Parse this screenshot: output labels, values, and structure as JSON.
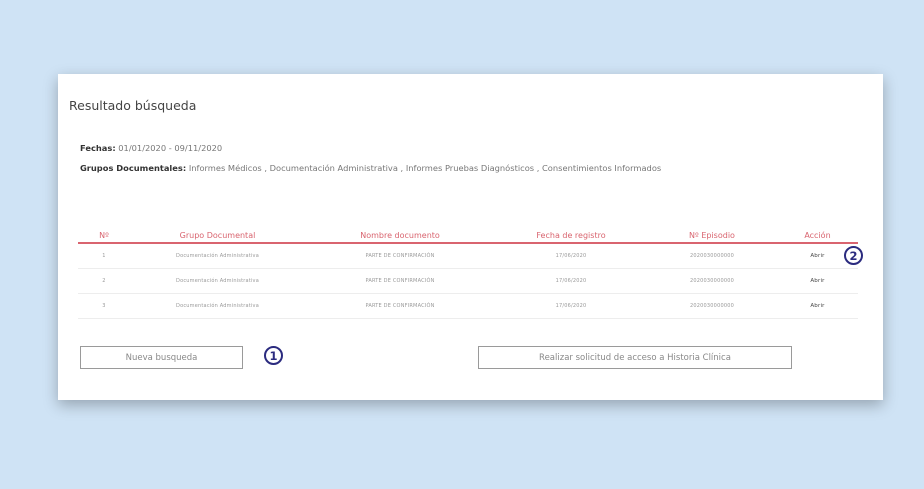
{
  "page": {
    "title": "Resultado búsqueda",
    "filters": {
      "fechas_label": "Fechas:",
      "fechas_value": "01/01/2020 - 09/11/2020",
      "grupos_label": "Grupos Documentales:",
      "grupos_value": "Informes Médicos , Documentación Administrativa , Informes Pruebas Diagnósticos , Consentimientos Informados"
    },
    "table": {
      "columns": [
        "Nº",
        "Grupo Documental",
        "Nombre documento",
        "Fecha de registro",
        "Nº Episodio",
        "Acción"
      ],
      "rows": [
        [
          "1",
          "Documentación Administrativa",
          "PARTE DE CONFIRMACIÓN",
          "17/06/2020",
          "2020030000000",
          "Abrir"
        ],
        [
          "2",
          "Documentación Administrativa",
          "PARTE DE CONFIRMACIÓN",
          "17/06/2020",
          "2020030000000",
          "Abrir"
        ],
        [
          "3",
          "Documentación Administrativa",
          "PARTE DE CONFIRMACIÓN",
          "17/06/2020",
          "2020030000000",
          "Abrir"
        ]
      ]
    },
    "buttons": {
      "new_search": "Nueva busqueda",
      "request_access": "Realizar solicitud de acceso a Historia Clínica"
    },
    "callouts": [
      "1",
      "2"
    ]
  }
}
